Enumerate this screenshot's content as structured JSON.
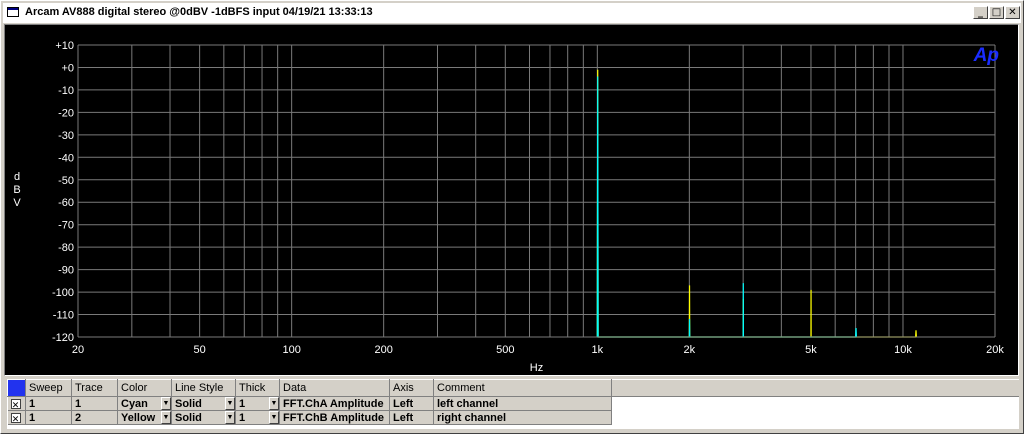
{
  "window": {
    "title": "Arcam AV888 digital stereo @0dBV -1dBFS input  04/19/21 13:33:13",
    "minimize_glyph": "_",
    "maximize_glyph": "□",
    "close_glyph": "✕"
  },
  "chart_data": {
    "type": "line",
    "xscale": "log",
    "xlim": [
      20,
      20000
    ],
    "ylim": [
      -120,
      10
    ],
    "xlabel": "Hz",
    "ylabel": "dBV",
    "ylabel_chars": [
      "d",
      "B",
      "V"
    ],
    "logo": "Ap",
    "grid": true,
    "y_ticks": [
      {
        "value": 10,
        "label": "+10"
      },
      {
        "value": 0,
        "label": "+0"
      },
      {
        "value": -10,
        "label": "-10"
      },
      {
        "value": -20,
        "label": "-20"
      },
      {
        "value": -30,
        "label": "-30"
      },
      {
        "value": -40,
        "label": "-40"
      },
      {
        "value": -50,
        "label": "-50"
      },
      {
        "value": -60,
        "label": "-60"
      },
      {
        "value": -70,
        "label": "-70"
      },
      {
        "value": -80,
        "label": "-80"
      },
      {
        "value": -90,
        "label": "-90"
      },
      {
        "value": -100,
        "label": "-100"
      },
      {
        "value": -110,
        "label": "-110"
      },
      {
        "value": -120,
        "label": "-120"
      }
    ],
    "x_ticks": [
      {
        "value": 20,
        "label": "20"
      },
      {
        "value": 50,
        "label": "50"
      },
      {
        "value": 100,
        "label": "100"
      },
      {
        "value": 200,
        "label": "200"
      },
      {
        "value": 500,
        "label": "500"
      },
      {
        "value": 1000,
        "label": "1k"
      },
      {
        "value": 2000,
        "label": "2k"
      },
      {
        "value": 5000,
        "label": "5k"
      },
      {
        "value": 10000,
        "label": "10k"
      },
      {
        "value": 20000,
        "label": "20k"
      }
    ],
    "x_gridlines": [
      20,
      30,
      40,
      50,
      60,
      70,
      80,
      90,
      100,
      200,
      300,
      400,
      500,
      600,
      700,
      800,
      900,
      1000,
      2000,
      3000,
      4000,
      5000,
      6000,
      7000,
      8000,
      9000,
      10000,
      20000
    ],
    "series": [
      {
        "name": "left channel",
        "color": "#ffff00",
        "points": [
          [
            1000,
            -120
          ],
          [
            1003,
            -1
          ],
          [
            1006,
            -120
          ],
          [
            2000,
            -120
          ],
          [
            2003,
            -97
          ],
          [
            2006,
            -120
          ],
          [
            3000,
            -120
          ],
          [
            3003,
            -103
          ],
          [
            3006,
            -120
          ],
          [
            5000,
            -120
          ],
          [
            5003,
            -99
          ],
          [
            5006,
            -120
          ],
          [
            11000,
            -120
          ],
          [
            11030,
            -117
          ],
          [
            11060,
            -120
          ]
        ]
      },
      {
        "name": "right channel",
        "color": "#00ffff",
        "points": [
          [
            1000,
            -120
          ],
          [
            1003,
            -4
          ],
          [
            1006,
            -120
          ],
          [
            2000,
            -120
          ],
          [
            2003,
            -112
          ],
          [
            2006,
            -120
          ],
          [
            3000,
            -120
          ],
          [
            3003,
            -96
          ],
          [
            3006,
            -120
          ],
          [
            7000,
            -120
          ],
          [
            7020,
            -116
          ],
          [
            7040,
            -120
          ]
        ]
      }
    ]
  },
  "legend": {
    "headers": [
      "Sweep",
      "Trace",
      "Color",
      "Line Style",
      "Thick",
      "Data",
      "Axis",
      "Comment"
    ],
    "rows": [
      {
        "checked": "✕",
        "sweep": "1",
        "trace": "1",
        "color": "Cyan",
        "style": "Solid",
        "thick": "1",
        "data": "FFT.ChA Amplitude",
        "axis": "Left",
        "comment": "left  channel"
      },
      {
        "checked": "✕",
        "sweep": "1",
        "trace": "2",
        "color": "Yellow",
        "style": "Solid",
        "thick": "1",
        "data": "FFT.ChB Amplitude",
        "axis": "Left",
        "comment": "right channel"
      }
    ],
    "dropdown_glyph": "▼"
  }
}
